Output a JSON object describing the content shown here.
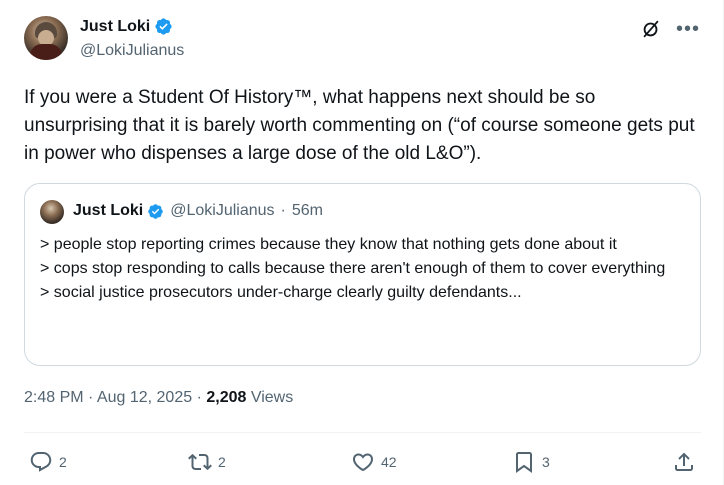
{
  "author": {
    "name": "Just Loki",
    "handle": "@LokiJulianus"
  },
  "tweet": {
    "text": "If you were a Student Of History™, what happens next should be so unsurprising that it is barely worth commenting on (“of course someone gets put in power who dispenses a large dose of the old L&O”)."
  },
  "quote": {
    "name": "Just Loki",
    "handle": "@LokiJulianus",
    "separator": "·",
    "time": "56m",
    "lines": [
      "> people stop reporting crimes because they know that nothing gets done about it",
      "> cops stop responding to calls because there aren't enough of them to cover everything",
      "> social justice prosecutors under-charge clearly guilty defendants..."
    ]
  },
  "meta": {
    "timestamp": "2:48 PM · Aug 12, 2025 · ",
    "views_count": "2,208",
    "views_label": " Views"
  },
  "actions": {
    "replies": "2",
    "reposts": "2",
    "likes": "42",
    "bookmarks": "3"
  },
  "icons": {
    "verified": "verified-badge-icon",
    "grok": "grok-icon",
    "more": "more-icon",
    "reply": "reply-icon",
    "repost": "repost-icon",
    "like": "like-icon",
    "bookmark": "bookmark-icon",
    "share": "share-icon"
  },
  "colors": {
    "verified_blue": "#1d9bf0",
    "secondary_text": "#536471",
    "border": "#cfd9de"
  }
}
